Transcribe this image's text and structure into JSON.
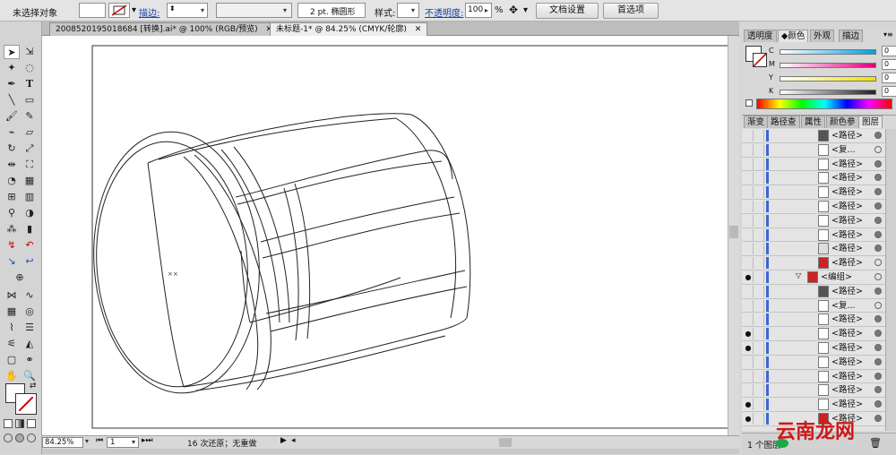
{
  "control_bar": {
    "selection_label": "未选择对象",
    "stroke_label": "描边:",
    "stroke_weight": "",
    "brush_value": "2 pt. 椭圆形",
    "style_label": "样式:",
    "opacity_label": "不透明度:",
    "opacity_value": "100",
    "opacity_unit": "%",
    "doc_setup_button": "文档设置",
    "prefs_button": "首选项"
  },
  "tabs": [
    {
      "label": "2008520195018684 [转换].ai* @ 100% (RGB/预览)",
      "active": false
    },
    {
      "label": "未标题-1* @ 84.25% (CMYK/轮廓)",
      "active": true
    }
  ],
  "status": {
    "zoom": "84.25%",
    "page": "1",
    "undo_text": "16 次还原；无重做"
  },
  "color_panel": {
    "tabs": [
      "透明度",
      "颜色",
      "外观",
      "描边"
    ],
    "active_tab": "颜色",
    "sliders": [
      {
        "label": "C",
        "value": "0",
        "color": "#00a0e0"
      },
      {
        "label": "M",
        "value": "0",
        "color": "#e0007a"
      },
      {
        "label": "Y",
        "value": "0",
        "color": "#f0e000"
      },
      {
        "label": "K",
        "value": "0",
        "color": "#222222"
      }
    ]
  },
  "layers_panel": {
    "tabs": [
      "渐变",
      "路径查",
      "属性",
      "颜色参",
      "图层"
    ],
    "active_tab": "图层",
    "rows": [
      {
        "name": "<路径>",
        "eye": false,
        "target": "filled",
        "thumb": "#555555"
      },
      {
        "name": "<复...",
        "eye": false,
        "target": "empty",
        "thumb": "#ffffff"
      },
      {
        "name": "<路径>",
        "eye": false,
        "target": "filled",
        "thumb": "#ffffff"
      },
      {
        "name": "<路径>",
        "eye": false,
        "target": "filled",
        "thumb": "#ffffff"
      },
      {
        "name": "<路径>",
        "eye": false,
        "target": "filled",
        "thumb": "#ffffff"
      },
      {
        "name": "<路径>",
        "eye": false,
        "target": "filled",
        "thumb": "#ffffff"
      },
      {
        "name": "<路径>",
        "eye": false,
        "target": "filled",
        "thumb": "#ffffff"
      },
      {
        "name": "<路径>",
        "eye": false,
        "target": "filled",
        "thumb": "#ffffff"
      },
      {
        "name": "<路径>",
        "eye": false,
        "target": "filled",
        "thumb": "#dddddd"
      },
      {
        "name": "<路径>",
        "eye": false,
        "target": "empty",
        "thumb": "#cc2222"
      },
      {
        "name": "<编组>",
        "eye": true,
        "target": "empty",
        "thumb": "#cc2222",
        "group": true
      },
      {
        "name": "<路径>",
        "eye": false,
        "target": "filled",
        "thumb": "#555555"
      },
      {
        "name": "<复...",
        "eye": false,
        "target": "empty",
        "thumb": "#ffffff"
      },
      {
        "name": "<路径>",
        "eye": false,
        "target": "filled",
        "thumb": "#ffffff"
      },
      {
        "name": "<路径>",
        "eye": true,
        "target": "filled",
        "thumb": "#ffffff"
      },
      {
        "name": "<路径>",
        "eye": true,
        "target": "filled",
        "thumb": "#ffffff"
      },
      {
        "name": "<路径>",
        "eye": false,
        "target": "filled",
        "thumb": "#ffffff"
      },
      {
        "name": "<路径>",
        "eye": false,
        "target": "filled",
        "thumb": "#ffffff"
      },
      {
        "name": "<路径>",
        "eye": false,
        "target": "filled",
        "thumb": "#ffffff"
      },
      {
        "name": "<路径>",
        "eye": true,
        "target": "filled",
        "thumb": "#ffffff"
      },
      {
        "name": "<路径>",
        "eye": true,
        "target": "filled",
        "thumb": "#cc2222"
      }
    ],
    "footer_text": "1 个图层"
  },
  "watermark": {
    "text": "云南龙网"
  }
}
